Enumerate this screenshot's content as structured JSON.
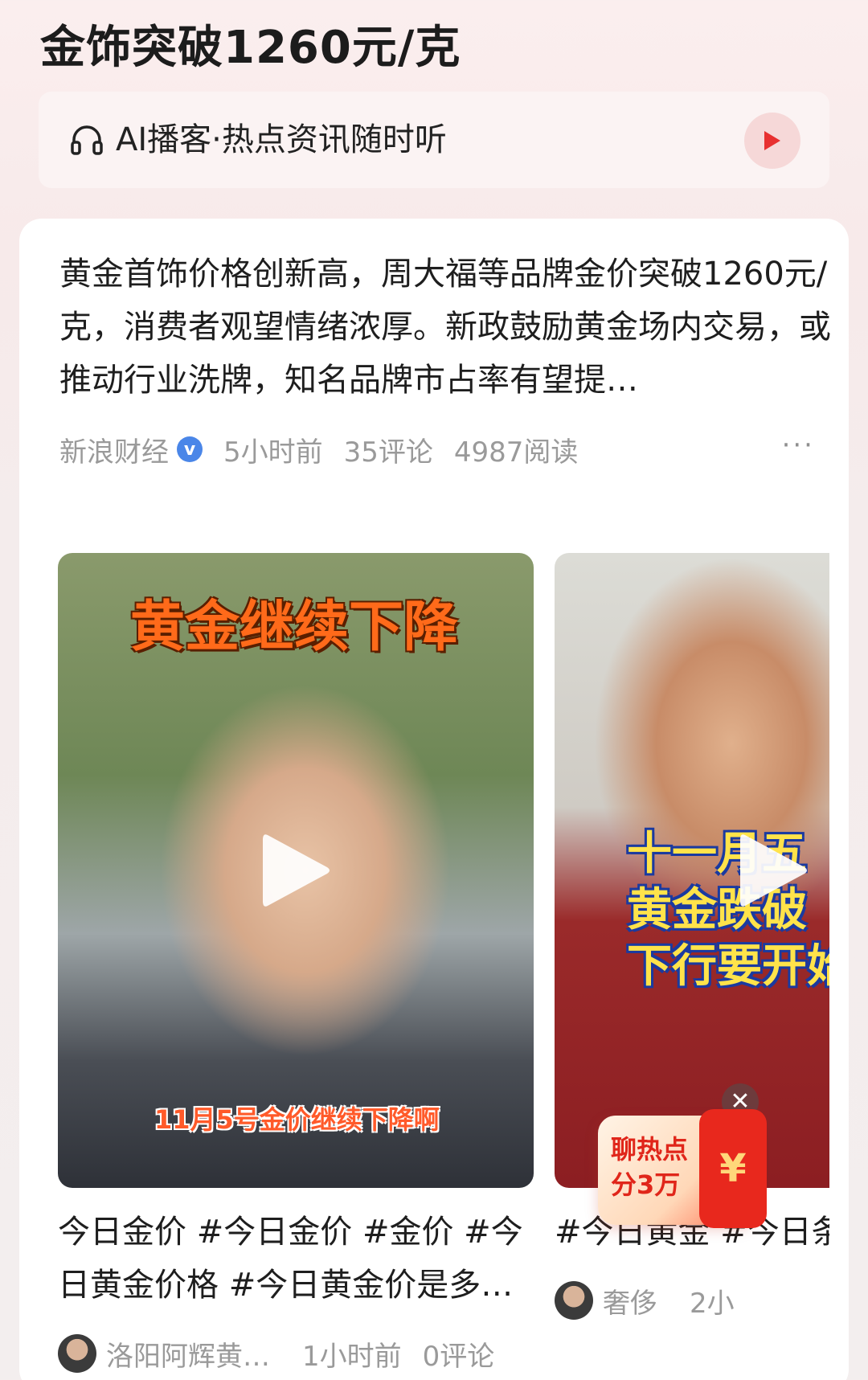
{
  "header": {
    "title": "金饰突破1260元/克"
  },
  "ai_bar": {
    "text": "AI播客·热点资讯随时听"
  },
  "article": {
    "summary": "黄金首饰价格创新高，周大福等品牌金价突破1260元/克，消费者观望情绪浓厚。新政鼓励黄金场内交易，或推动行业洗牌，知名品牌市占率有望提…",
    "source": "新浪财经",
    "verified_mark": "v",
    "time": "5小时前",
    "comments": "35评论",
    "reads": "4987阅读",
    "more": "···"
  },
  "videos": [
    {
      "headline": "黄金继续下降",
      "subcaption": "11月5号金价继续下降啊",
      "title": "今日金价 #今日金价 #金价 #今日黄金价格 #今日黄金价是多…",
      "author": "洛阳阿辉黄…",
      "time": "1小时前",
      "comments": "0评论"
    },
    {
      "caption_lines": [
        "十一月五",
        "黄金跌破",
        "下行要开始"
      ],
      "title": "#今日黄金 #今日条价格…",
      "author": "奢侈",
      "time": "2小"
    }
  ],
  "promo": {
    "text": "聊热点分3万",
    "yen": "¥",
    "close": "✕"
  }
}
